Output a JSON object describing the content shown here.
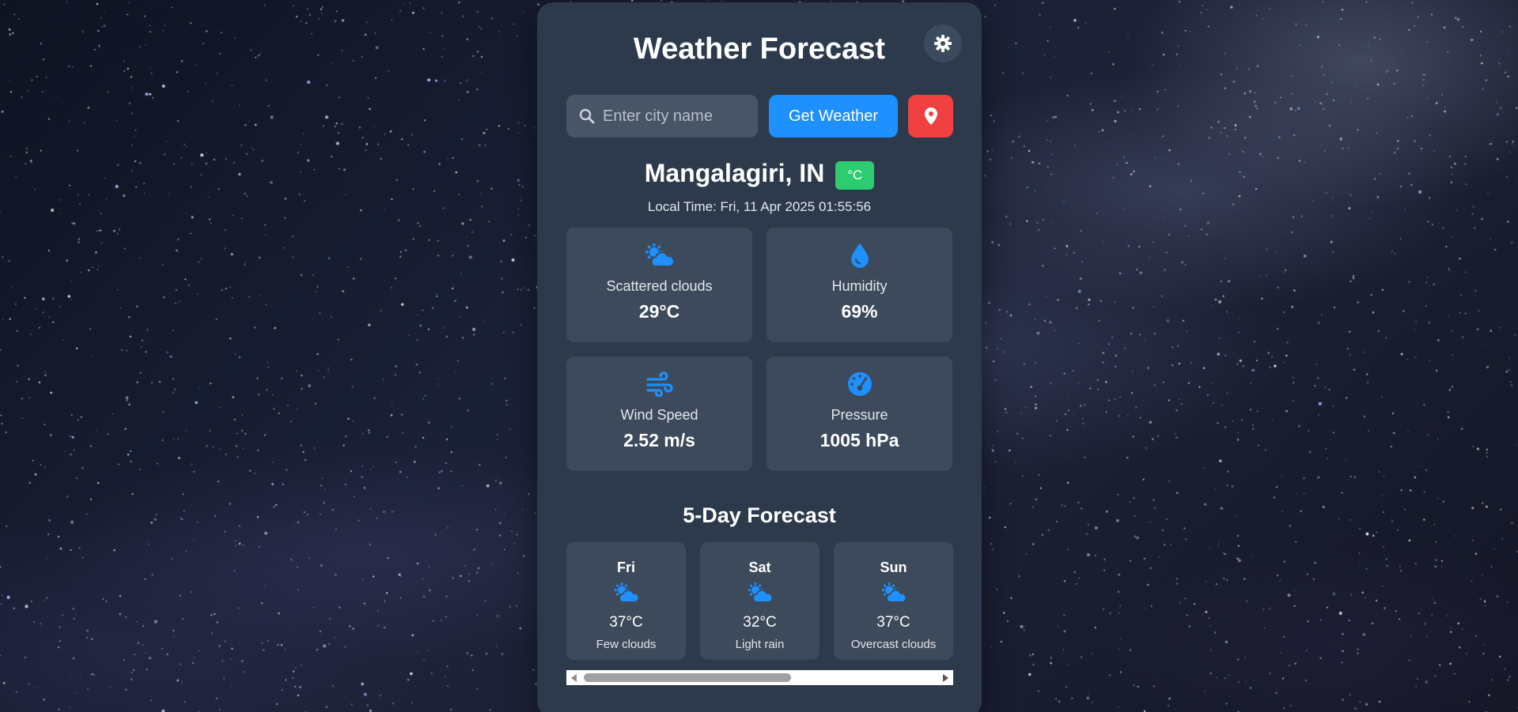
{
  "app": {
    "title": "Weather Forecast",
    "theme_toggle_icon": "gear-icon"
  },
  "search": {
    "placeholder": "Enter city name",
    "value": "",
    "button_label": "Get Weather",
    "location_icon": "map-marker-icon"
  },
  "location": {
    "city": "Mangalagiri, IN",
    "unit_label": "°C",
    "local_time": "Local Time: Fri, 11 Apr 2025 01:55:56"
  },
  "current": [
    {
      "icon": "cloud-sun-icon",
      "label": "Scattered clouds",
      "value": "29°C"
    },
    {
      "icon": "droplet-icon",
      "label": "Humidity",
      "value": "69%"
    },
    {
      "icon": "wind-icon",
      "label": "Wind Speed",
      "value": "2.52 m/s"
    },
    {
      "icon": "gauge-icon",
      "label": "Pressure",
      "value": "1005 hPa"
    }
  ],
  "forecast": {
    "title": "5-Day Forecast",
    "days": [
      {
        "day": "Fri",
        "icon": "cloud-sun-icon",
        "temp": "37°C",
        "desc": "Few clouds"
      },
      {
        "day": "Sat",
        "icon": "cloud-sun-icon",
        "temp": "32°C",
        "desc": "Light rain"
      },
      {
        "day": "Sun",
        "icon": "cloud-sun-icon",
        "temp": "37°C",
        "desc": "Overcast clouds"
      }
    ]
  },
  "colors": {
    "accent_blue": "#1e90ff",
    "location_red": "#f04040",
    "unit_green": "#2ecc71",
    "card_bg": "#2d3a4c",
    "tile_bg": "#3d4a5b"
  }
}
